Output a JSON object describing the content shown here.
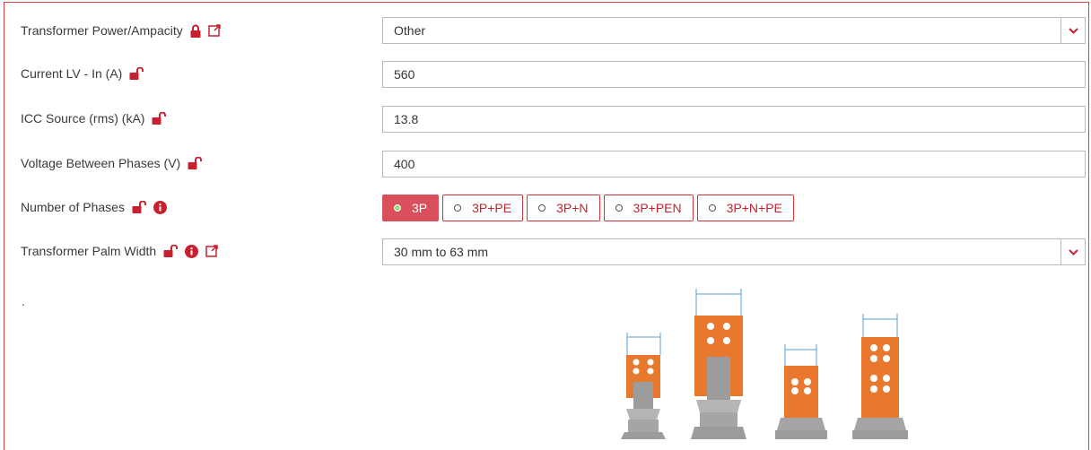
{
  "fields": {
    "transformer_power": {
      "label": "Transformer Power/Ampacity",
      "value": "Other"
    },
    "current_lv": {
      "label": "Current LV - In (A)",
      "value": "560"
    },
    "icc_source": {
      "label": "ICC Source (rms) (kA)",
      "value": "13.8"
    },
    "voltage": {
      "label": "Voltage Between Phases (V)",
      "value": "400"
    },
    "phases": {
      "label": "Number of Phases",
      "options": [
        "3P",
        "3P+PE",
        "3P+N",
        "3P+PEN",
        "3P+N+PE"
      ],
      "selected": "3P"
    },
    "palm_width": {
      "label": "Transformer Palm Width",
      "value": "30 mm to 63 mm"
    }
  },
  "extra_label": ".",
  "colors": {
    "accent": "#c8202e",
    "selected_bg": "#d9505c",
    "palm_orange": "#e8782e",
    "palm_grey": "#a9a9a9"
  },
  "icons": [
    "lock-closed-icon",
    "lock-open-icon",
    "info-icon",
    "external-link-icon",
    "chevron-down-icon"
  ]
}
